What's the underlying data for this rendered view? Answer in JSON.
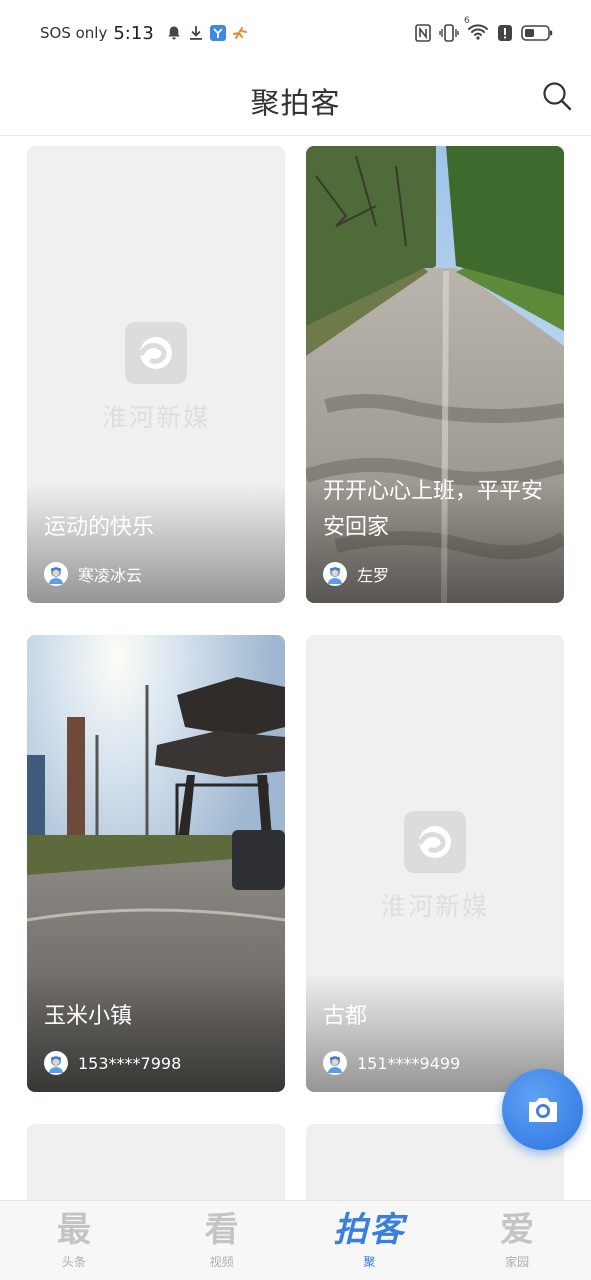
{
  "status_bar": {
    "network": "SOS only",
    "time": "5:13",
    "left_icons": [
      "bell-icon",
      "download-icon",
      "app-notification-icon",
      "runner-icon"
    ],
    "right_icons": [
      "nfc-icon",
      "vibrate-icon",
      "wifi-icon",
      "alert-icon",
      "battery-icon"
    ],
    "wifi_badge": "6"
  },
  "header": {
    "title": "聚拍客"
  },
  "placeholder": {
    "text": "淮河新媒"
  },
  "cards": [
    {
      "caption": "运动的快乐",
      "author": "寒凌冰云",
      "has_photo": false
    },
    {
      "caption": "开开心心上班，平平安安回家",
      "author": "左罗",
      "has_photo": true
    },
    {
      "caption": "玉米小镇",
      "author": "153****7998",
      "has_photo": true
    },
    {
      "caption": "古都",
      "author": "151****9499",
      "has_photo": false
    }
  ],
  "tabs": [
    {
      "glyph": "最",
      "label": "头条",
      "active": false
    },
    {
      "glyph": "看",
      "label": "视频",
      "active": false
    },
    {
      "glyph": "拍客",
      "label": "聚",
      "active": true
    },
    {
      "glyph": "爱",
      "label": "家园",
      "active": false
    }
  ],
  "colors": {
    "accent": "#3a7ee0",
    "fab": "#2d74de",
    "placeholder_bg": "#f0f0f0"
  },
  "fab": {
    "icon": "camera-icon"
  }
}
